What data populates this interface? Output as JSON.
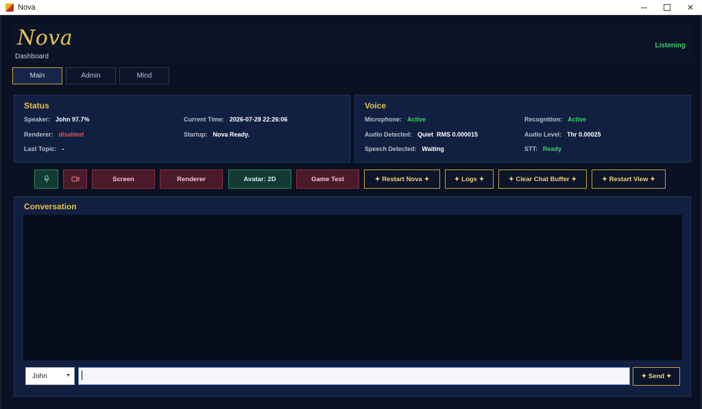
{
  "window": {
    "title": "Nova"
  },
  "header": {
    "logo": "Nova",
    "subtitle": "Dashboard",
    "status": "Listening"
  },
  "tabs": [
    {
      "label": "Main",
      "active": true
    },
    {
      "label": "Admin",
      "active": false
    },
    {
      "label": "Mind",
      "active": false
    }
  ],
  "status_panel": {
    "title": "Status",
    "speaker_label": "Speaker:",
    "speaker_value": "John 97.7%",
    "renderer_label": "Renderer:",
    "renderer_value": "disabled",
    "last_topic_label": "Last Topic:",
    "last_topic_value": "-",
    "current_time_label": "Current Time:",
    "current_time_value": "2026-07-28 22:26:06",
    "startup_label": "Startup:",
    "startup_value": "Nova Ready."
  },
  "voice_panel": {
    "title": "Voice",
    "microphone_label": "Microphone:",
    "microphone_value": "Active",
    "audio_detected_label": "Audio Detected:",
    "audio_detected_value": "Quiet  RMS 0.000015",
    "speech_detected_label": "Speech Detected:",
    "speech_detected_value": "Waiting",
    "recognition_label": "Recognition:",
    "recognition_value": "Active",
    "audio_level_label": "Audio Level:",
    "audio_level_value": "Thr 0.00025",
    "stt_label": "STT:",
    "stt_value": "Ready"
  },
  "toolbar": {
    "mic_icon": "microphone-icon",
    "camera_icon": "video-camera-icon",
    "screen": "Screen",
    "renderer": "Renderer",
    "avatar": "Avatar: 2D",
    "game_test": "Game Test",
    "restart_nova": "✦ Restart Nova ✦",
    "logs": "✦ Logs ✦",
    "clear_chat_buffer": "✦ Clear Chat Buffer ✦",
    "restart_view": "✦ Restart View ✦"
  },
  "conversation": {
    "title": "Conversation",
    "user_select": "John",
    "input_value": "",
    "send_label": "✦ Send ✦"
  },
  "colors": {
    "accent_gold": "#e8c04a",
    "status_green": "#3fcf6e",
    "status_red": "#e0505e",
    "panel_bg": "#112040"
  }
}
